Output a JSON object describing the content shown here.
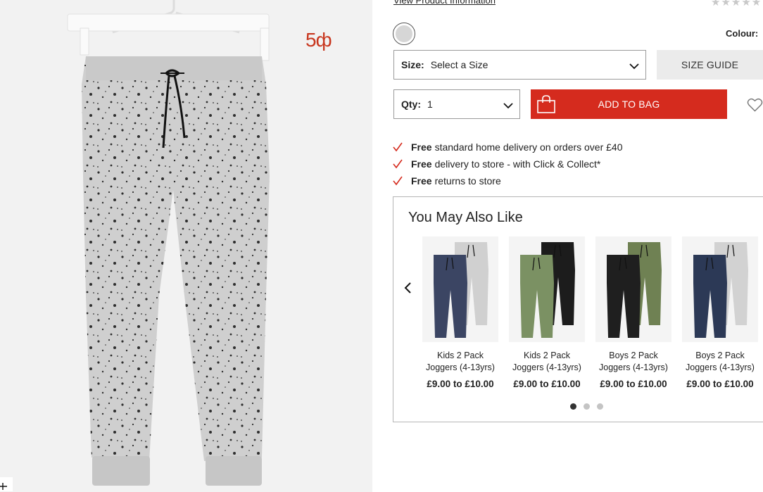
{
  "product": {
    "badge": "5ф",
    "view_info_link": "View Product Information",
    "rating_stars": "★★★★★",
    "colour_label": "Colour:",
    "size": {
      "label": "Size:",
      "value": "Select a Size"
    },
    "size_guide": "SIZE GUIDE",
    "qty": {
      "label": "Qty:",
      "value": "1"
    },
    "add_to_bag": "ADD TO BAG"
  },
  "perks": [
    {
      "bold": "Free",
      "text": "standard home delivery on orders over £40"
    },
    {
      "bold": "Free",
      "text": "delivery to store - with Click & Collect*"
    },
    {
      "bold": "Free",
      "text": "returns to store"
    }
  ],
  "recommendations": {
    "title": "You May Also Like",
    "items": [
      {
        "name_line1": "Kids 2 Pack",
        "name_line2": "Joggers (4-13yrs)",
        "price": "£9.00 to £10.00",
        "colors": [
          "#3b4563",
          "#d0d0d0"
        ]
      },
      {
        "name_line1": "Kids 2 Pack",
        "name_line2": "Joggers (4-13yrs)",
        "price": "£9.00 to £10.00",
        "colors": [
          "#7b9163",
          "#1c1c1c"
        ]
      },
      {
        "name_line1": "Boys 2 Pack",
        "name_line2": "Joggers (4-13yrs)",
        "price": "£9.00 to £10.00",
        "colors": [
          "#1f1f1f",
          "#6f8153"
        ]
      },
      {
        "name_line1": "Boys 2 Pack",
        "name_line2": "Joggers (4-13yrs)",
        "price": "£9.00 to £10.00",
        "colors": [
          "#2c3956",
          "#d2d2d2"
        ]
      }
    ],
    "pages": 3,
    "active_page": 1
  },
  "colors": {
    "accent": "#d52b1e",
    "badge": "#c8371f",
    "swatch": "#d6d6d6"
  }
}
